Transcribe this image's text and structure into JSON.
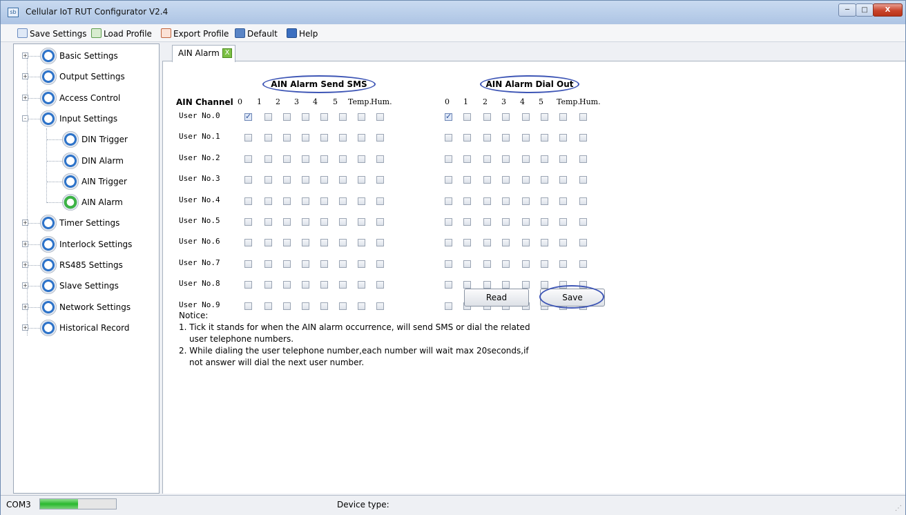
{
  "window": {
    "title": "Cellular IoT RUT Configurator V2.4",
    "app_icon": "sb",
    "controls": [
      "─",
      "□",
      "X"
    ]
  },
  "toolbar": [
    {
      "label": "Save Settings",
      "icon": "save-icon"
    },
    {
      "label": "Load Profile",
      "icon": "load-icon"
    },
    {
      "label": "Export Profile",
      "icon": "export-icon"
    },
    {
      "label": "Default",
      "icon": "default-icon"
    },
    {
      "label": "Help",
      "icon": "help-icon"
    }
  ],
  "tree": [
    {
      "label": "Basic Settings",
      "expand": "+"
    },
    {
      "label": "Output Settings",
      "expand": "+"
    },
    {
      "label": "Access Control",
      "expand": "+"
    },
    {
      "label": "Input Settings",
      "expand": "-"
    },
    {
      "label": "DIN Trigger"
    },
    {
      "label": "DIN Alarm"
    },
    {
      "label": "AIN Trigger"
    },
    {
      "label": "AIN Alarm",
      "selected": true
    },
    {
      "label": "Timer Settings",
      "expand": "+"
    },
    {
      "label": "Interlock Settings",
      "expand": "+"
    },
    {
      "label": "RS485 Settings",
      "expand": "+"
    },
    {
      "label": "Slave Settings",
      "expand": "+"
    },
    {
      "label": "Network Settings",
      "expand": "+"
    },
    {
      "label": "Historical Record",
      "expand": "+"
    }
  ],
  "tab": {
    "label": "AIN Alarm",
    "close": "X"
  },
  "sections": {
    "sms": "AIN Alarm Send SMS",
    "dial": "AIN Alarm Dial Out"
  },
  "channel_label": "AIN Channel",
  "channels": [
    "0",
    "1",
    "2",
    "3",
    "4",
    "5",
    "Temp.",
    "Hum."
  ],
  "users": [
    "User No.0",
    "User No.1",
    "User No.2",
    "User No.3",
    "User No.4",
    "User No.5",
    "User No.6",
    "User No.7",
    "User No.8",
    "User No.9"
  ],
  "checked": {
    "sms": [
      [
        0,
        0
      ]
    ],
    "dial": [
      [
        0,
        0
      ]
    ]
  },
  "buttons": {
    "read": "Read",
    "save": "Save"
  },
  "notice": {
    "title": "Notice:",
    "line1": "1. Tick it stands for when the AIN alarm occurrence, will send SMS or dial the related",
    "line1b": "user telephone numbers.",
    "line2": "2. While dialing the user telephone number,each number will wait max 20seconds,if",
    "line2b": "not answer will dial the next user number."
  },
  "status": {
    "port": "COM3",
    "progress": 0.5,
    "device_type": "Device type:"
  },
  "colors": {
    "accent_oval": "#3d55b5",
    "progress": "#29b82e"
  }
}
